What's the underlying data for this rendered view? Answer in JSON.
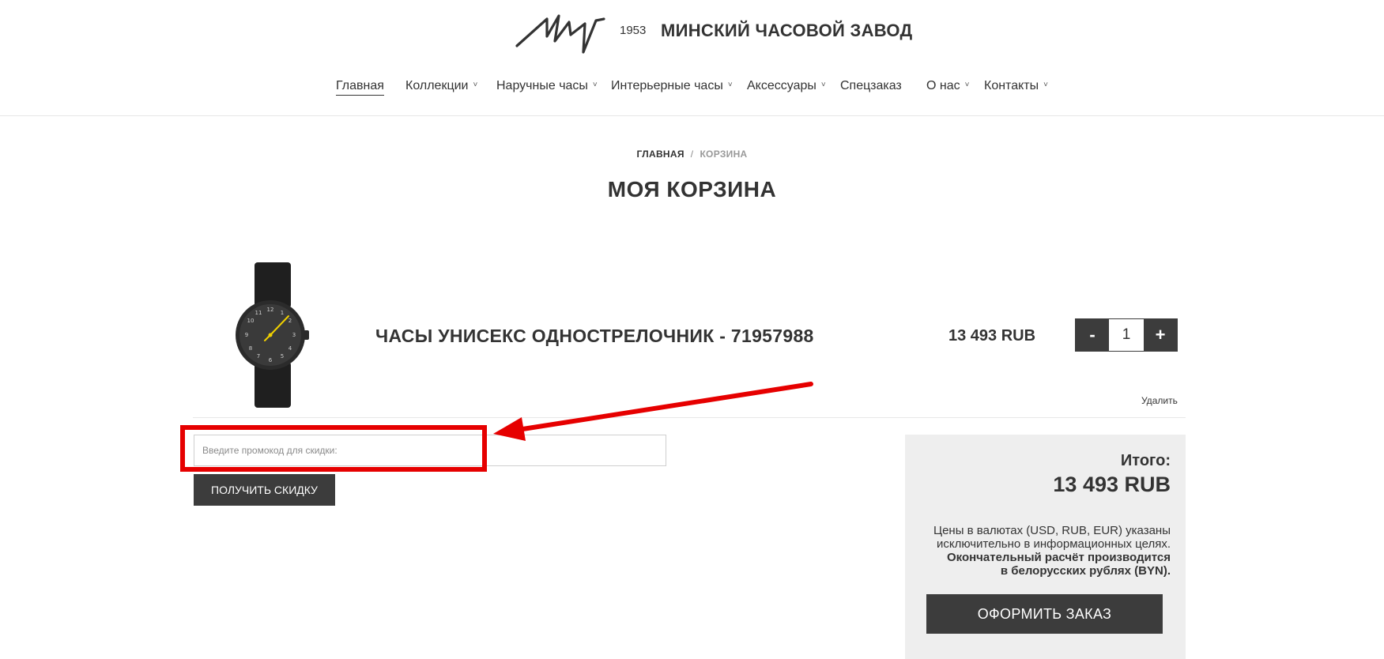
{
  "header": {
    "logo_year": "1953",
    "logo_name": "МИНСКИЙ ЧАСОВОЙ ЗАВОД"
  },
  "nav": {
    "items": [
      {
        "label": "Главная",
        "active": true,
        "dropdown": false
      },
      {
        "label": "Коллекции",
        "active": false,
        "dropdown": true
      },
      {
        "label": "Наручные часы",
        "active": false,
        "dropdown": true
      },
      {
        "label": "Интерьерные часы",
        "active": false,
        "dropdown": true
      },
      {
        "label": "Аксессуары",
        "active": false,
        "dropdown": true
      },
      {
        "label": "Спецзаказ",
        "active": false,
        "dropdown": false
      },
      {
        "label": "О нас",
        "active": false,
        "dropdown": true
      },
      {
        "label": "Контакты",
        "active": false,
        "dropdown": true
      }
    ],
    "chevron_glyph": "˅"
  },
  "breadcrumb": {
    "home": "ГЛАВНАЯ",
    "separator": "/",
    "current": "КОРЗИНА"
  },
  "page_title": "МОЯ КОРЗИНА",
  "cart": {
    "item": {
      "name": "ЧАСЫ УНИСЕКС ОДНОСТРЕЛОЧНИК - 71957988",
      "price": "13 493 RUB",
      "quantity": "1",
      "minus_label": "-",
      "plus_label": "+",
      "remove_label": "Удалить",
      "image_icon": "watch-image"
    }
  },
  "promo": {
    "placeholder": "Введите промокод для скидки:",
    "value": "",
    "button_label": "ПОЛУЧИТЬ СКИДКУ",
    "highlight_color": "#e60000"
  },
  "summary": {
    "total_label": "Итого:",
    "total_value": "13 493 RUB",
    "notice_line1": "Цены в валютах (USD, RUB, EUR) указаны",
    "notice_line2": "исключительно в информационных целях.",
    "notice_line3": "Окончательный расчёт производится",
    "notice_line4": "в белорусских рублях (BYN).",
    "order_button": "ОФОРМИТЬ ЗАКАЗ"
  },
  "colors": {
    "dark_button": "#3c3c3c",
    "text": "#333333",
    "summary_bg": "#eeeeee",
    "annotation_red": "#e60000"
  }
}
